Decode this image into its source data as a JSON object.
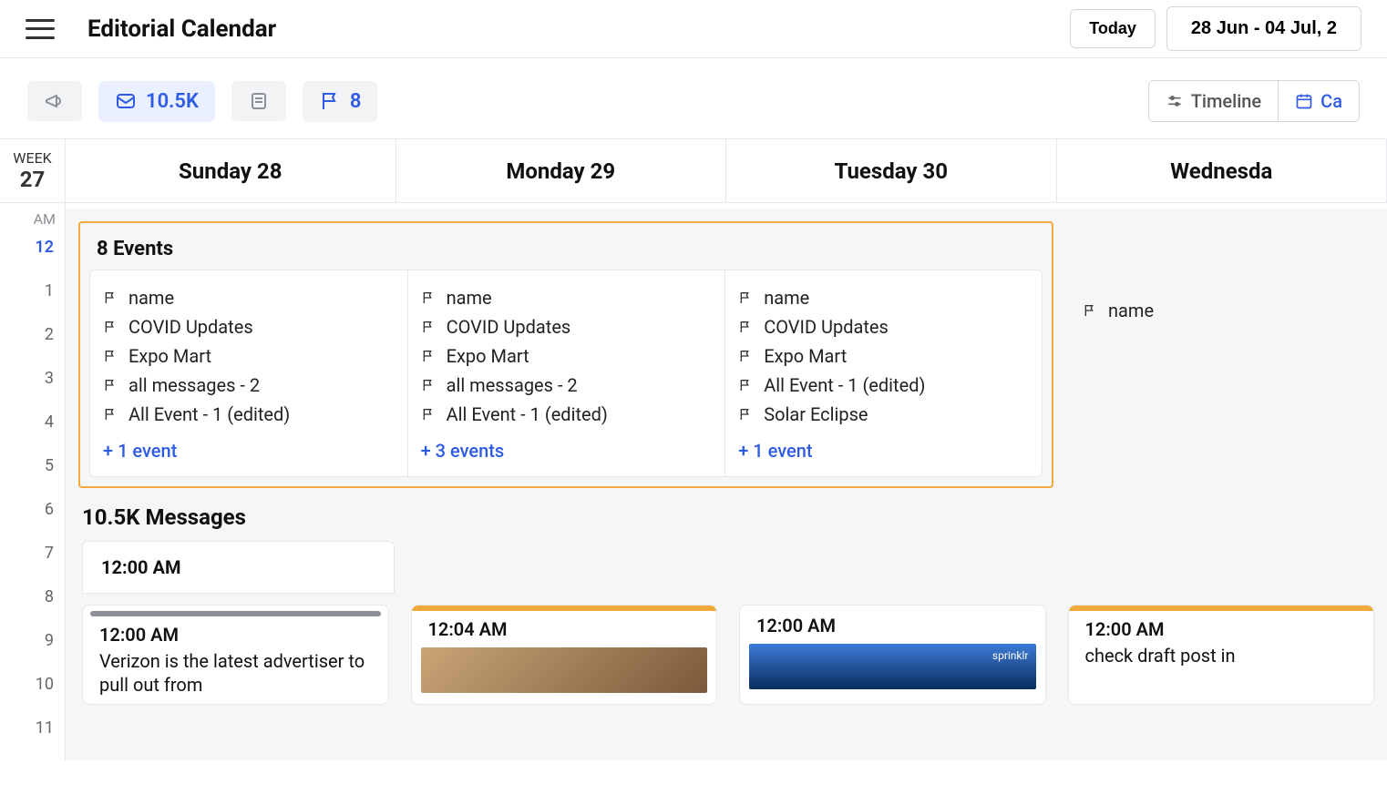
{
  "header": {
    "title": "Editorial Calendar",
    "today_label": "Today",
    "date_range": "28 Jun - 04 Jul, 2"
  },
  "toolbar": {
    "mail_count": "10.5K",
    "flag_count": "8",
    "timeline_label": "Timeline",
    "calendar_label": "Ca"
  },
  "week": {
    "label": "WEEK",
    "number": "27"
  },
  "time_axis": {
    "am_label": "AM",
    "slots": [
      "12",
      "1",
      "2",
      "3",
      "4",
      "5",
      "6",
      "7",
      "8",
      "9",
      "10",
      "11"
    ]
  },
  "days": [
    "Sunday 28",
    "Monday 29",
    "Tuesday 30",
    "Wednesda"
  ],
  "events_section": {
    "title": "8 Events",
    "columns": [
      {
        "items": [
          "name",
          "COVID Updates",
          "Expo Mart",
          "all messages - 2",
          "All Event - 1 (edited)"
        ],
        "more": "+ 1 event"
      },
      {
        "items": [
          "name",
          "COVID Updates",
          "Expo Mart",
          "all messages - 2",
          "All Event - 1 (edited)"
        ],
        "more": "+ 3 events"
      },
      {
        "items": [
          "name",
          "COVID Updates",
          "Expo Mart",
          "All Event - 1 (edited)",
          "Solar Eclipse"
        ],
        "more": "+ 1 event"
      }
    ],
    "extra_col": {
      "items": [
        "name"
      ]
    }
  },
  "messages_section": {
    "title": "10.5K Messages",
    "header_time": "12:00 AM",
    "cards": [
      {
        "bar": "grey",
        "time": "12:00 AM",
        "text": "Verizon is the latest advertiser to pull out from"
      },
      {
        "bar": "orange",
        "time": "12:04 AM",
        "text": "",
        "image": "brown"
      },
      {
        "bar": "none",
        "time": "12:00 AM",
        "text": "",
        "image": "blue"
      },
      {
        "bar": "orange",
        "time": "12:00 AM",
        "text": "check draft post in"
      }
    ]
  }
}
